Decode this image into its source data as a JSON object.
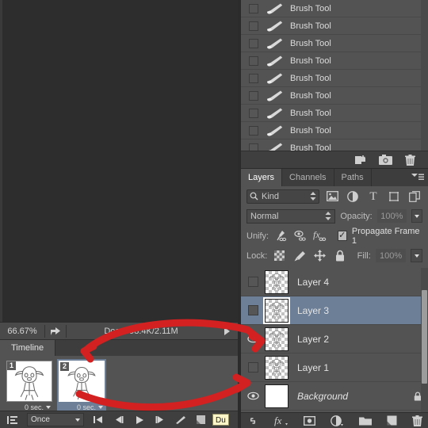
{
  "status_bar": {
    "zoom": "66.67%",
    "doc_info": "Doc: 398.4K/2.11M",
    "share_icon": "share-icon",
    "arrow_icon": "play-arrow-icon"
  },
  "timeline": {
    "tab_label": "Timeline",
    "frames": [
      {
        "number": "1",
        "duration": "0 sec.",
        "selected": false
      },
      {
        "number": "2",
        "duration": "0 sec.",
        "selected": true
      }
    ],
    "toolbar": {
      "tween_style_icon": "frame-align-icon",
      "loop_value": "Once",
      "first_frame_icon": "first-frame-icon",
      "prev_frame_icon": "previous-frame-icon",
      "play_icon": "play-icon",
      "next_frame_icon": "next-frame-icon",
      "tween_icon": "tween-icon",
      "duplicate_icon": "duplicate-frame-icon",
      "tooltip_text": "Du"
    }
  },
  "history": {
    "rows": [
      {
        "label": "Brush Tool"
      },
      {
        "label": "Brush Tool"
      },
      {
        "label": "Brush Tool"
      },
      {
        "label": "Brush Tool"
      },
      {
        "label": "Brush Tool"
      },
      {
        "label": "Brush Tool"
      },
      {
        "label": "Brush Tool"
      },
      {
        "label": "Brush Tool"
      },
      {
        "label": "Brush Tool"
      }
    ],
    "toolbar": {
      "new_document_icon": "new-document-from-state-icon",
      "snapshot_icon": "camera-snapshot-icon",
      "delete_icon": "trash-icon"
    }
  },
  "layers": {
    "tabs": [
      {
        "label": "Layers",
        "active": true
      },
      {
        "label": "Channels",
        "active": false
      },
      {
        "label": "Paths",
        "active": false
      }
    ],
    "panel_menu_icon": "panel-menu-icon",
    "filter": {
      "kind_label": "Kind",
      "search_icon": "search-icon",
      "icons": [
        "pixel-filter-icon",
        "adjustment-filter-icon",
        "type-filter-icon",
        "shape-filter-icon",
        "smart-object-filter-icon"
      ]
    },
    "blend": {
      "mode": "Normal",
      "opacity_label": "Opacity:",
      "opacity_value": "100%"
    },
    "unify": {
      "label": "Unify:",
      "icons": [
        "unify-position-icon",
        "unify-visibility-icon",
        "unify-style-icon"
      ],
      "propagate_label": "Propagate Frame 1",
      "propagate_checked": true,
      "check_glyph": "✓"
    },
    "lock": {
      "label": "Lock:",
      "icons": [
        "lock-transparency-icon",
        "lock-image-icon",
        "lock-position-icon",
        "lock-all-icon"
      ],
      "fill_label": "Fill:",
      "fill_value": "100%"
    },
    "list": [
      {
        "name": "Layer 4",
        "visible": false,
        "selected": false,
        "background": false
      },
      {
        "name": "Layer 3",
        "visible": false,
        "selected": true,
        "background": false
      },
      {
        "name": "Layer 2",
        "visible": true,
        "selected": false,
        "background": false
      },
      {
        "name": "Layer 1",
        "visible": false,
        "selected": false,
        "background": false
      },
      {
        "name": "Background",
        "visible": true,
        "selected": false,
        "background": true
      }
    ],
    "toolbar": {
      "link_icon": "link-layers-icon",
      "fx_icon": "layer-style-fx-icon",
      "mask_icon": "add-layer-mask-icon",
      "adjustment_icon": "new-adjustment-layer-icon",
      "group_icon": "new-group-folder-icon",
      "new_layer_icon": "new-layer-icon",
      "delete_icon": "trash-icon"
    }
  },
  "annotations": {
    "color": "#d32020",
    "arrow_1": "arrow-to-frame-2",
    "arrow_2": "arrow-to-layer-1-visibility"
  }
}
